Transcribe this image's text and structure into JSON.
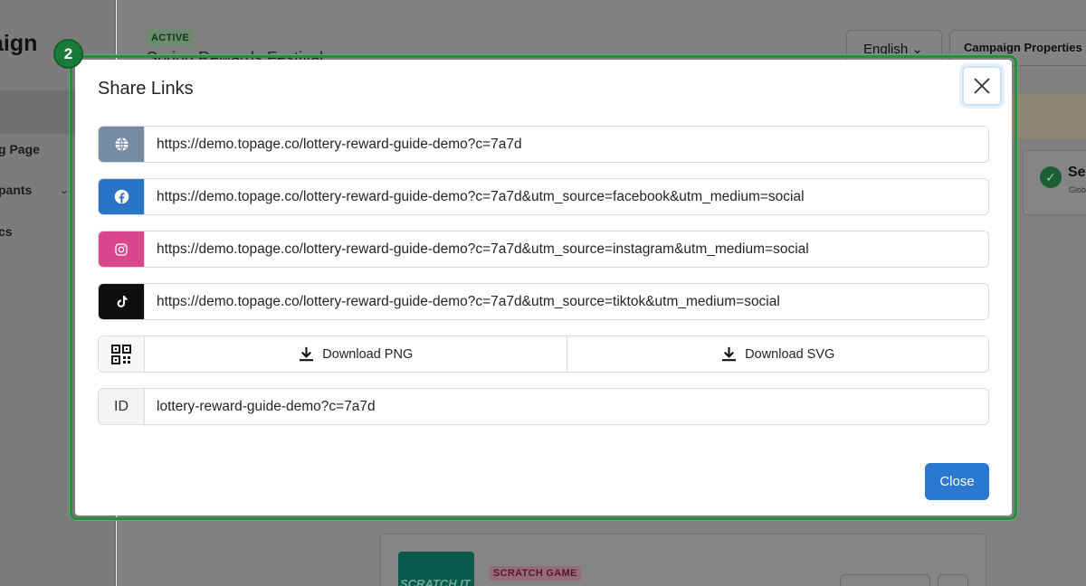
{
  "background": {
    "brand": "aign",
    "nav_items": [
      "g Page",
      "pants",
      "cs"
    ],
    "badge_active": "ACTIVE",
    "campaign_title": "Spring Rewards Festival",
    "language": "English",
    "campaign_properties": "Campaign Properties",
    "settings_partial": "Se",
    "settings_sub": "Glob",
    "scratch_badge": "SCRATCH GAME",
    "thumb_text": "SCRATCH IT"
  },
  "step_badge": "2",
  "modal": {
    "title": "Share Links",
    "links": [
      {
        "icon": "globe-icon",
        "url": "https://demo.topage.co/lottery-reward-guide-demo?c=7a7d"
      },
      {
        "icon": "facebook-icon",
        "url": "https://demo.topage.co/lottery-reward-guide-demo?c=7a7d&utm_source=facebook&utm_medium=social"
      },
      {
        "icon": "instagram-icon",
        "url": "https://demo.topage.co/lottery-reward-guide-demo?c=7a7d&utm_source=instagram&utm_medium=social"
      },
      {
        "icon": "tiktok-icon",
        "url": "https://demo.topage.co/lottery-reward-guide-demo?c=7a7d&utm_source=tiktok&utm_medium=social"
      }
    ],
    "download_png": "Download PNG",
    "download_svg": "Download SVG",
    "id_label": "ID",
    "id_value": "lottery-reward-guide-demo?c=7a7d",
    "close_button": "Close"
  },
  "colors": {
    "highlight": "#2d8a3e",
    "primary": "#2a78d0",
    "facebook": "#2a74c8",
    "instagram": "#d9468c",
    "tiktok": "#0e0e0e",
    "web": "#778aa3"
  }
}
